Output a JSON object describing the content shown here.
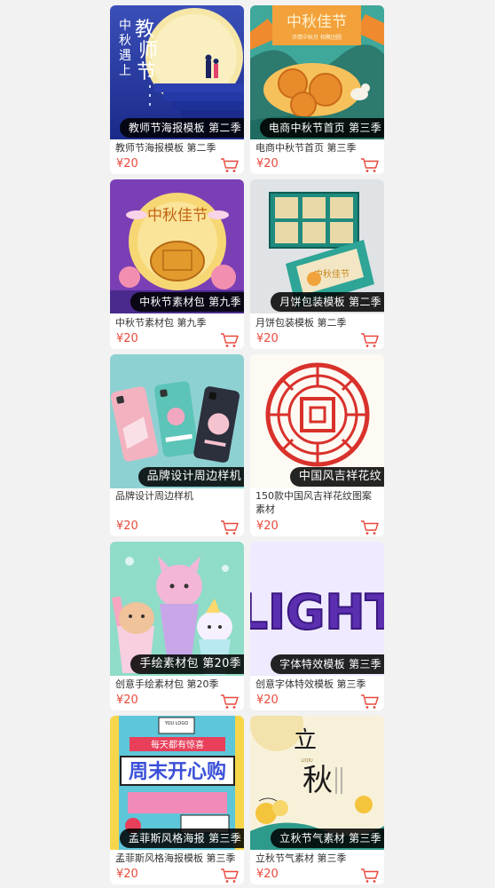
{
  "colors": {
    "price": "#e84a3c",
    "cart": "#e8473b",
    "ribbon_bg": "#000000",
    "page_bg": "#f2f2f2"
  },
  "cart_icon": "shopping-cart-icon",
  "cards": [
    {
      "ribbon": "教师节海报模板 第二季",
      "title": "教师节海报模板 第二季",
      "price": "¥20",
      "art_text": [
        "教",
        "师",
        "节",
        "中",
        "秋",
        "遇",
        "上"
      ]
    },
    {
      "ribbon": "电商中秋节首页 第三季",
      "title": "电商中秋节首页 第三季",
      "price": "¥20",
      "art_text": [
        "中秋佳节",
        "浓情中秋月 相聚团圆"
      ]
    },
    {
      "ribbon": "中秋节素材包 第九季",
      "title": "中秋节素材包 第九季",
      "price": "¥20",
      "art_text": [
        "中秋佳节"
      ]
    },
    {
      "ribbon": "月饼包装模板 第二季",
      "title": "月饼包装模板 第二季",
      "price": "¥20",
      "art_text": [
        "中秋佳节"
      ]
    },
    {
      "ribbon": "品牌设计周边样机",
      "title": "品牌设计周边样机",
      "price": "¥20",
      "art_text": []
    },
    {
      "ribbon": "中国风吉祥花纹",
      "title": "150款中国风吉祥花纹图案素材",
      "price": "¥20",
      "art_text": []
    },
    {
      "ribbon": "手绘素材包 第20季",
      "title": "创意手绘素材包 第20季",
      "price": "¥20",
      "art_text": []
    },
    {
      "ribbon": "字体特效模板 第三季",
      "title": "创意字体特效模板 第三季",
      "price": "¥20",
      "art_text": [
        "LIGHT"
      ]
    },
    {
      "ribbon": "孟菲斯风格海报 第三季",
      "title": "孟菲斯风格海报模板 第三季",
      "price": "¥20",
      "art_text": [
        "每天都有惊喜",
        "周末开心购",
        "YOU LOGO"
      ]
    },
    {
      "ribbon": "立秋节气素材 第三季",
      "title": "立秋节气素材 第三季",
      "price": "¥20",
      "art_text": [
        "立",
        "秋",
        "LIQIU"
      ]
    }
  ]
}
